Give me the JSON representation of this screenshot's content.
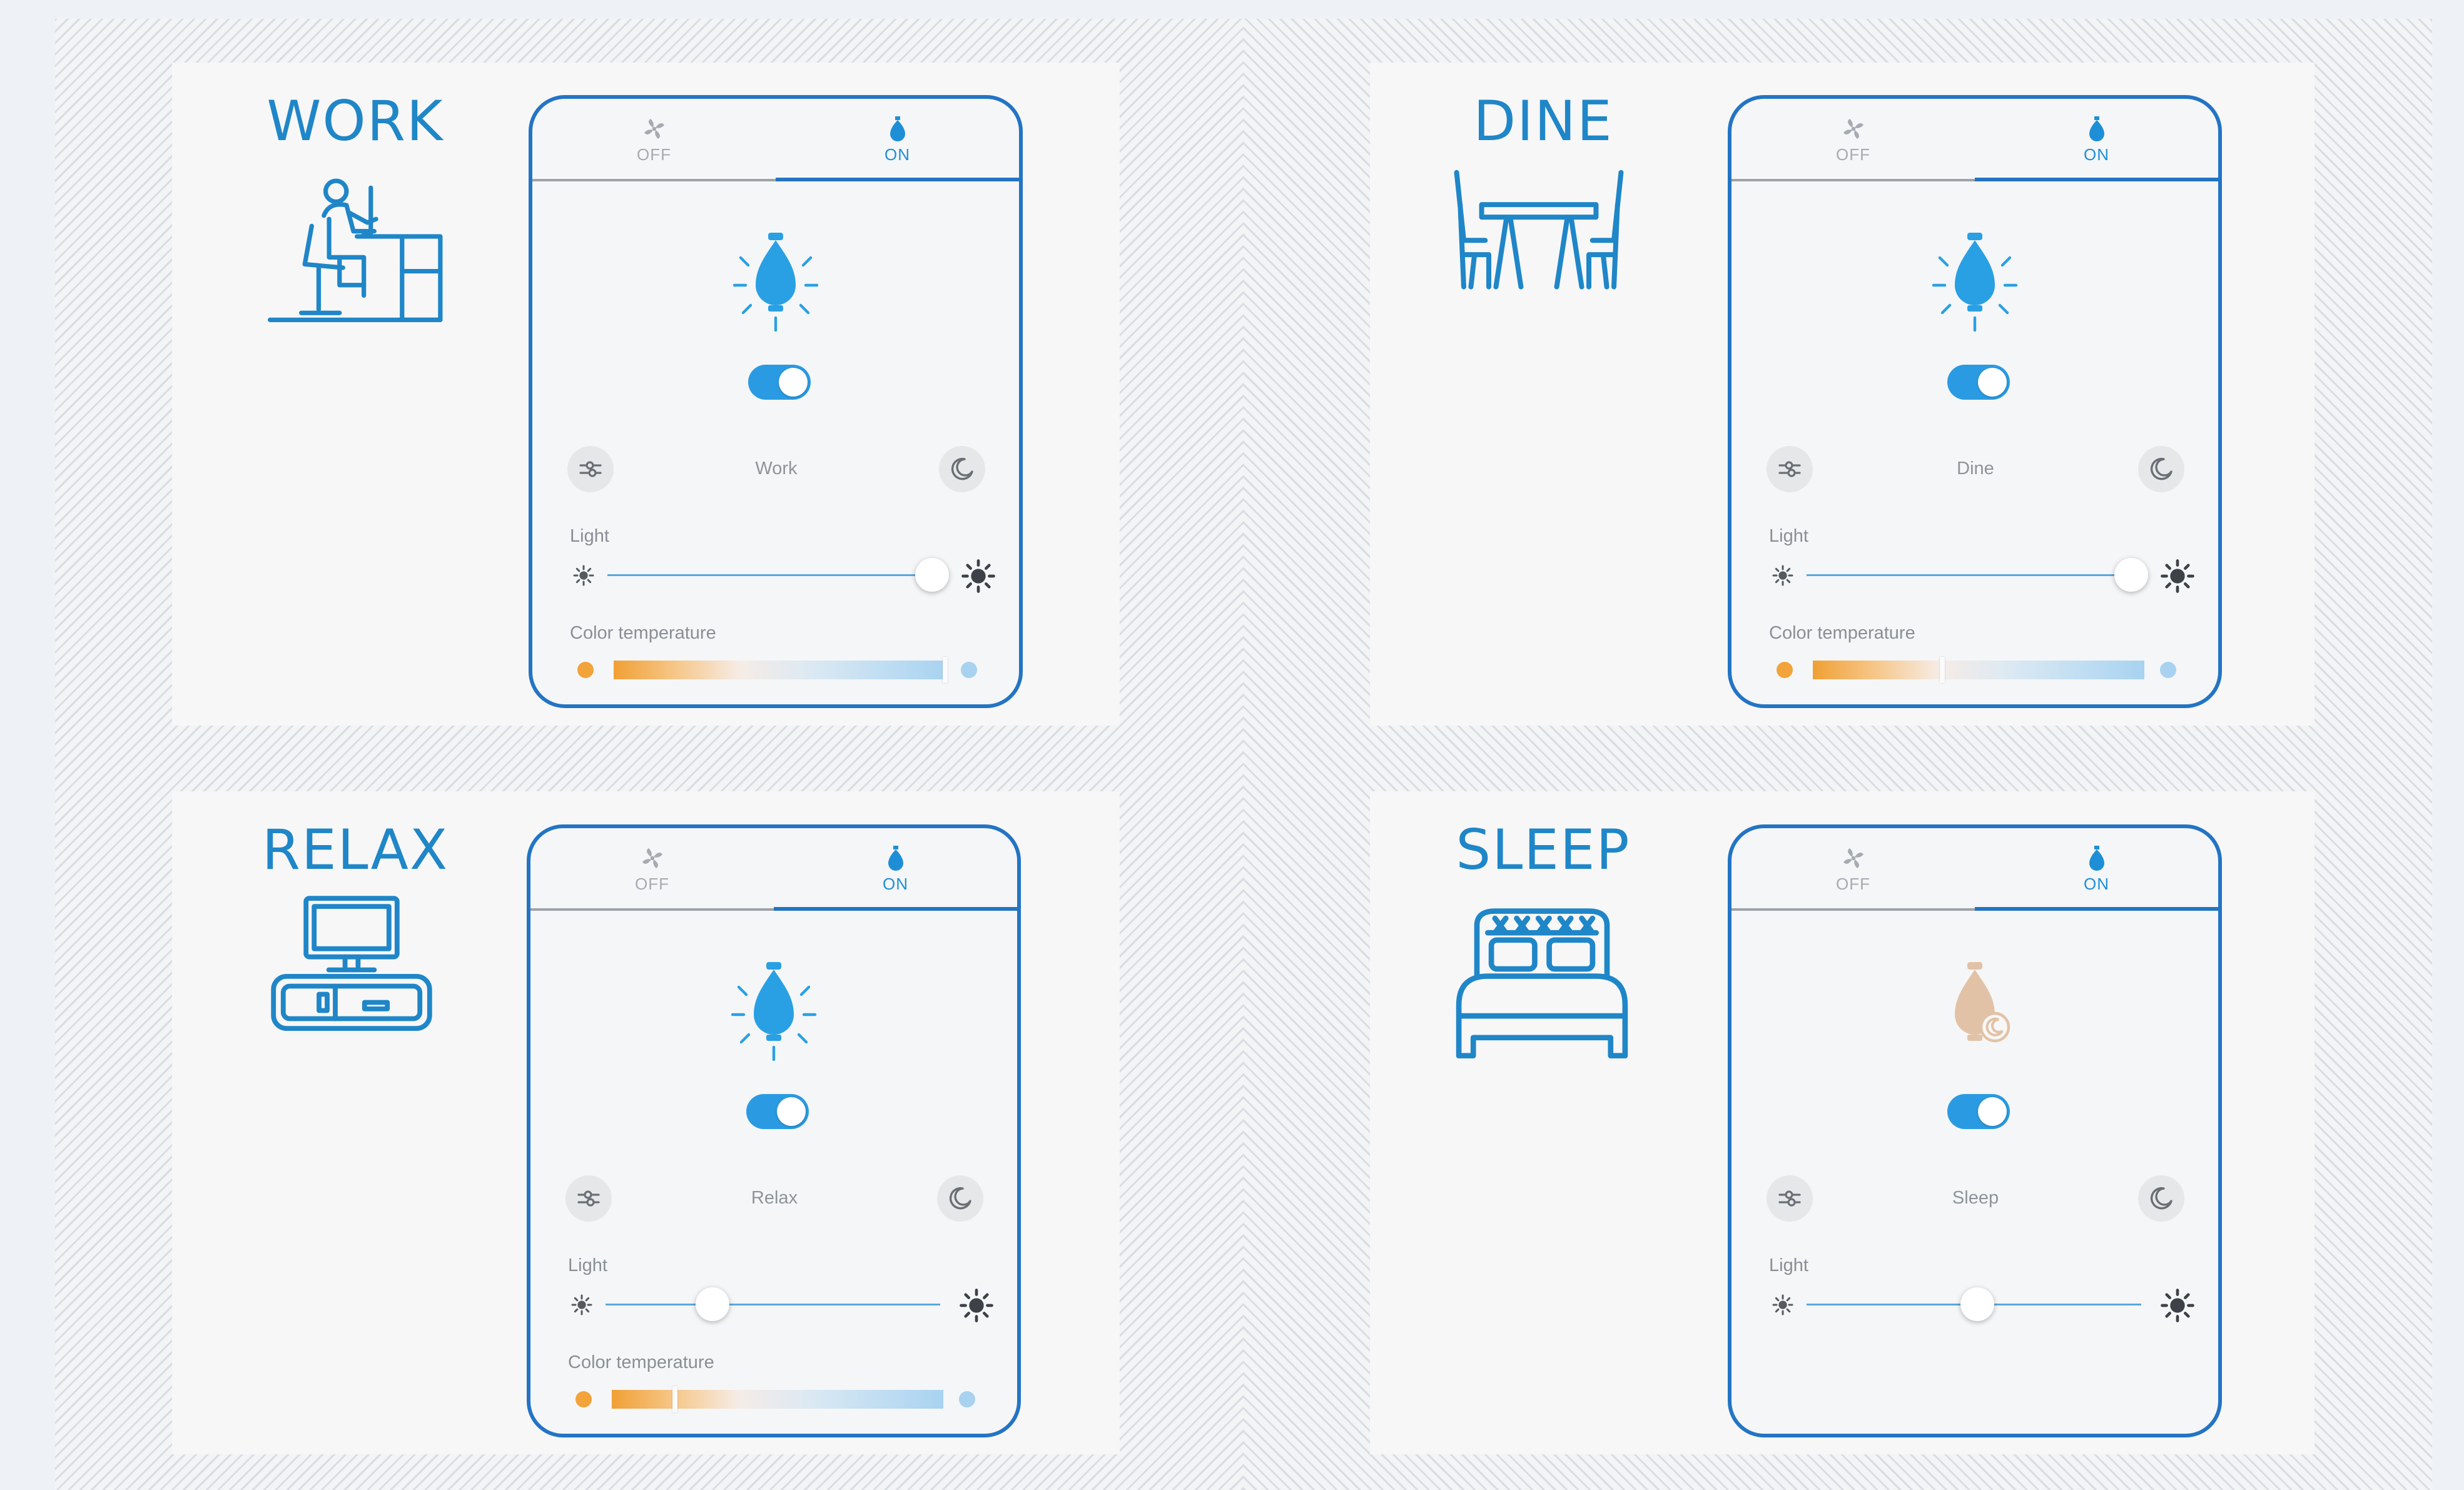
{
  "scenes": [
    {
      "title": "WORK",
      "icon": "person-at-desk-icon",
      "tabs": {
        "off": "OFF",
        "on": "ON"
      },
      "bulb_state": "on",
      "label": "Work",
      "light_label": "Light",
      "brightness": 0.97,
      "color_temp_label": "Color temperature",
      "color_temp": 1.0
    },
    {
      "title": "DINE",
      "icon": "dining-table-icon",
      "tabs": {
        "off": "OFF",
        "on": "ON"
      },
      "bulb_state": "on",
      "label": "Dine",
      "light_label": "Light",
      "brightness": 0.97,
      "color_temp_label": "Color temperature",
      "color_temp": 0.39
    },
    {
      "title": "RELAX",
      "icon": "tv-stand-icon",
      "tabs": {
        "off": "OFF",
        "on": "ON"
      },
      "bulb_state": "on",
      "label": "Relax",
      "light_label": "Light",
      "brightness": 0.32,
      "color_temp_label": "Color temperature",
      "color_temp": 0.19
    },
    {
      "title": "SLEEP",
      "icon": "bed-icon",
      "tabs": {
        "off": "OFF",
        "on": "ON"
      },
      "bulb_state": "night",
      "label": "Sleep",
      "light_label": "Light",
      "brightness": 0.51
    }
  ],
  "colors": {
    "accent": "#2374c4",
    "icon_blue": "#1f86c8",
    "bulb_on": "#29a0e3",
    "bulb_night": "#e2c2a6",
    "warm": "#f2a33a",
    "cool": "#a8d2f0"
  }
}
